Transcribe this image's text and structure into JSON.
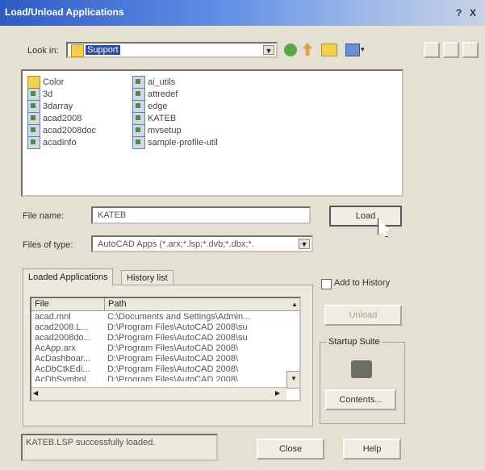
{
  "window": {
    "title": "Load/Unload Applications",
    "help_btn": "?",
    "close_btn": "X"
  },
  "look_in": {
    "label": "Look in:",
    "value": "Support"
  },
  "files_col1": [
    "Color",
    "3d",
    "3darray",
    "acad2008",
    "acad2008doc",
    "acadinfo"
  ],
  "files_col2": [
    "ai_utils",
    "attredef",
    "edge",
    "KATEB",
    "mvsetup",
    "sample-profile-util"
  ],
  "file_name": {
    "label": "File name:",
    "value": "KATEB"
  },
  "files_of_type": {
    "label": "Files of type:",
    "value": "AutoCAD Apps (*.arx;*.lsp;*.dvb;*.dbx;*."
  },
  "load_btn": "Load",
  "tabs": [
    "Loaded Applications",
    "History list"
  ],
  "add_to_history": "Add to History",
  "unload_btn": "Unload",
  "startup_suite": {
    "label": "Startup Suite",
    "contents_btn": "Contents..."
  },
  "loaded_table": {
    "headers": [
      "File",
      "Path"
    ],
    "rows": [
      [
        "acad.mnl",
        "C:\\Documents and Settings\\Admin..."
      ],
      [
        "acad2008.L...",
        "D:\\Program Files\\AutoCAD 2008\\su"
      ],
      [
        "acad2008do...",
        "D:\\Program Files\\AutoCAD 2008\\su"
      ],
      [
        "AcApp.arx",
        "D:\\Program Files\\AutoCAD 2008\\"
      ],
      [
        "AcDashboar...",
        "D:\\Program Files\\AutoCAD 2008\\"
      ],
      [
        "AcDbCtkEdi...",
        "D:\\Program Files\\AutoCAD 2008\\"
      ],
      [
        "AcDbSymbol...",
        "D:\\Program Files\\AutoCAD 2008\\"
      ]
    ]
  },
  "status": "KATEB.LSP successfully loaded.",
  "close_btn": "Close",
  "help_btn": "Help"
}
